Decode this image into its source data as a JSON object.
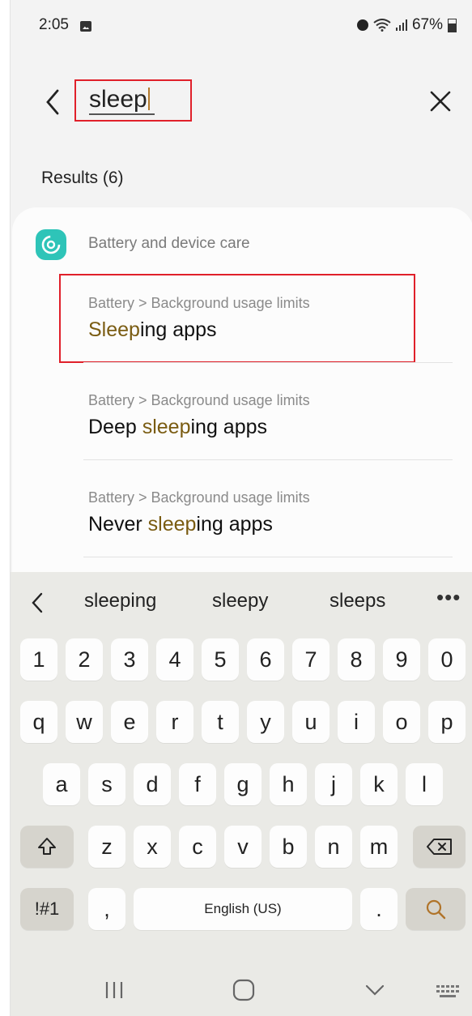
{
  "status_bar": {
    "time": "2:05",
    "battery": "67%",
    "icons": [
      "gallery-icon",
      "alarm-icon",
      "wifi-icon",
      "signal-icon",
      "battery-icon"
    ]
  },
  "search": {
    "query": "sleep",
    "results_count": "Results (6)"
  },
  "results": {
    "category": "Battery and device care",
    "category_icon": "battery-device-care-icon",
    "items": [
      {
        "path": "Battery > Background usage limits",
        "pre": "",
        "match": "Sleep",
        "post": "ing apps"
      },
      {
        "path": "Battery > Background usage limits",
        "pre": "Deep ",
        "match": "sleep",
        "post": "ing apps"
      },
      {
        "path": "Battery > Background usage limits",
        "pre": "Never ",
        "match": "sleep",
        "post": "ing apps"
      }
    ]
  },
  "keyboard": {
    "suggestions": [
      "sleeping",
      "sleepy",
      "sleeps"
    ],
    "more": "•••",
    "row_numbers": [
      "1",
      "2",
      "3",
      "4",
      "5",
      "6",
      "7",
      "8",
      "9",
      "0"
    ],
    "row_1": [
      "q",
      "w",
      "e",
      "r",
      "t",
      "y",
      "u",
      "i",
      "o",
      "p"
    ],
    "row_2": [
      "a",
      "s",
      "d",
      "f",
      "g",
      "h",
      "j",
      "k",
      "l"
    ],
    "row_3": [
      "z",
      "x",
      "c",
      "v",
      "b",
      "n",
      "m"
    ],
    "symbols_key": "!#1",
    "comma_key": ",",
    "space_label": "English (US)",
    "period_key": "."
  },
  "colors": {
    "highlight_text": "#7a5c12",
    "annotation_red": "#e0202a",
    "app_icon_teal": "#2ec4b8",
    "keyboard_bg": "#eaeae6"
  }
}
